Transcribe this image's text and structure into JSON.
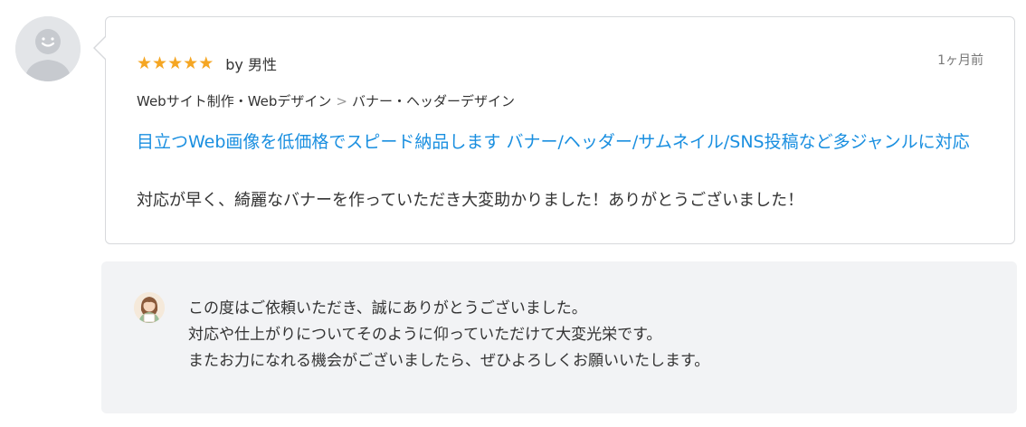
{
  "review": {
    "rating": 5,
    "stars": [
      "★",
      "★",
      "★",
      "★",
      "★"
    ],
    "reviewer": "by 男性",
    "date": "1ヶ月前",
    "breadcrumb": {
      "category": "Webサイト制作・Webデザイン",
      "separator": ">",
      "subcategory": "バナー・ヘッダーデザイン"
    },
    "service_title": "目立つWeb画像を低価格でスピード納品します バナー/ヘッダー/サムネイル/SNS投稿など多ジャンルに対応",
    "comment": "対応が早く、綺麗なバナーを作っていただき大変助かりました！ありがとうございました！"
  },
  "reply": {
    "lines": [
      "この度はご依頼いただき、誠にありがとうございました。",
      "対応や仕上がりについてそのように仰っていただけて大変光栄です。",
      "またお力になれる機会がございましたら、ぜひよろしくお願いいたします。"
    ]
  },
  "colors": {
    "star": "#f5a623",
    "link": "#1a8fe0",
    "reply_background": "#f2f3f5",
    "card_border": "#d7d9dc"
  },
  "icons": {
    "reviewer_avatar": "default-user-avatar-icon",
    "seller_avatar": "seller-avatar-icon",
    "star": "star-icon"
  }
}
